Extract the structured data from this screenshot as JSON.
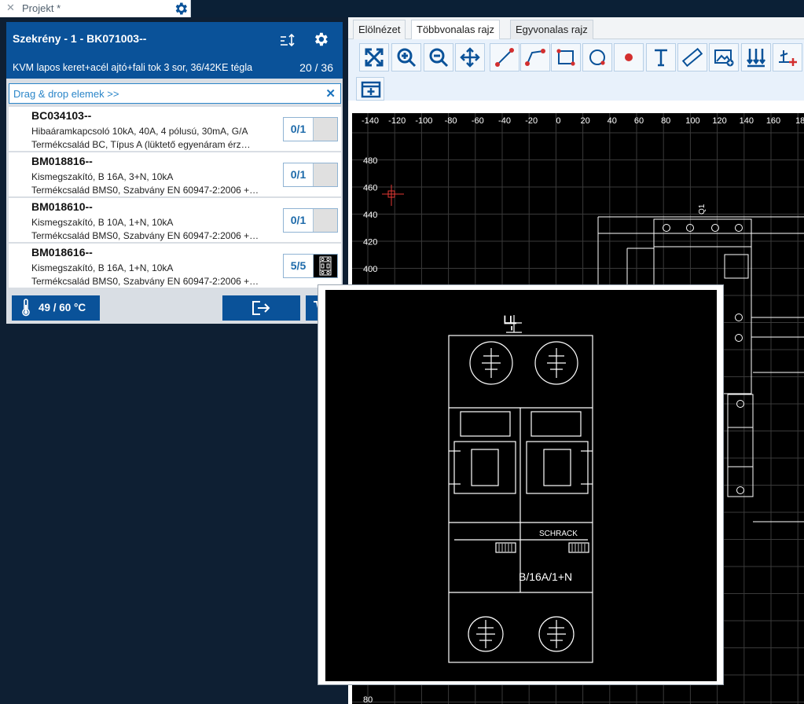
{
  "project_tab": {
    "title": "Projekt *"
  },
  "cabinet": {
    "title": "Szekrény - 1 - BK071003--",
    "subtitle": "KVM lapos keret+acél ajtó+fali tok 3 sor, 36/42KE tégla",
    "count": "20 / 36"
  },
  "dragdrop": {
    "label": "Drag & drop elemek  >>"
  },
  "items": [
    {
      "code": "BC034103--",
      "desc1": "Hibaáramkapcsoló 10kA, 40A, 4 pólusú, 30mA, G/A",
      "desc2": "Termékcsalád BC, Típus A (lüktető egyenáram érz…",
      "qty": "0/1"
    },
    {
      "code": "BM018816--",
      "desc1": "Kismegszakító, B 16A, 3+N, 10kA",
      "desc2": "Termékcsalád BMS0, Szabvány EN 60947-2:2006 +…",
      "qty": "0/1"
    },
    {
      "code": "BM018610--",
      "desc1": "Kismegszakító, B 10A, 1+N, 10kA",
      "desc2": "Termékcsalád BMS0, Szabvány EN 60947-2:2006 +…",
      "qty": "0/1"
    },
    {
      "code": "BM018616--",
      "desc1": "Kismegszakító, B 16A, 1+N, 10kA",
      "desc2": "Termékcsalád BMS0, Szabvány EN 60947-2:2006 +…",
      "qty": "5/5"
    }
  ],
  "temperature": "49 / 60 °C",
  "tabs": [
    "Elölnézet",
    "Többvonalas rajz",
    "Egyvonalas rajz"
  ],
  "toolbar_icons": [
    "fit-view-icon",
    "zoom-in-icon",
    "zoom-out-icon",
    "pan-icon",
    "line-icon",
    "polyline-icon",
    "rectangle-icon",
    "circle-icon",
    "point-icon",
    "text-icon",
    "measure-icon",
    "insert-image-icon",
    "distribute-icon",
    "add-terminal-icon",
    "add-frame-icon"
  ],
  "ruler_x": [
    "-140",
    "-120",
    "-100",
    "-80",
    "-60",
    "-40",
    "-20",
    "0",
    "20",
    "40",
    "60",
    "80",
    "100",
    "120",
    "140",
    "160",
    "18"
  ],
  "ruler_y": [
    "480",
    "460",
    "440",
    "420",
    "400"
  ],
  "ruler_y_bottom": "80",
  "drawing_label": "Q1",
  "preview": {
    "designator": "-F",
    "brand": "SCHRACK",
    "rating": "B/16A/1+N"
  },
  "colors": {
    "primary": "#0a5299",
    "accent": "#2b86c9",
    "cursor": "#e53935"
  }
}
